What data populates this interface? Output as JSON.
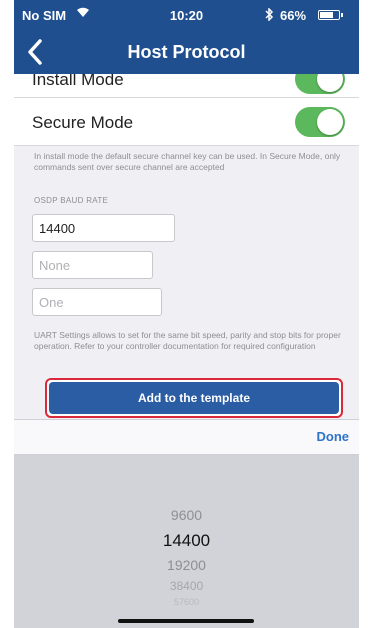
{
  "status_bar": {
    "carrier": "No SIM",
    "time": "10:20",
    "bluetooth_icon": "bluetooth-icon",
    "battery_percent": "66%",
    "battery_level": 0.66
  },
  "nav": {
    "title": "Host Protocol",
    "back_icon": "chevron-left-icon"
  },
  "settings": {
    "install_mode_label": "Install Mode",
    "install_mode_on": true,
    "secure_mode_label": "Secure Mode",
    "secure_mode_on": true,
    "secure_note": "In install mode the default secure channel key can be used. In Secure Mode, only commands sent over secure channel are accepted",
    "baud_caption": "OSDP BAUD RATE",
    "baud_value": "14400",
    "parity_placeholder": "None",
    "stop_bits_placeholder": "One",
    "uart_note": "UART Settings allows to set for the same bit speed, parity and stop bits for proper operation. Refer to your controller documentation for required configuration",
    "add_button": "Add to the template"
  },
  "toolbar": {
    "done": "Done"
  },
  "picker": {
    "options": [
      "9600",
      "14400",
      "19200",
      "38400",
      "57600"
    ],
    "selected": "14400"
  },
  "colors": {
    "nav_bg": "#1f4f8f",
    "toggle_on": "#5cb85c",
    "button_bg": "#2a5da4",
    "highlight_border": "#d9293a",
    "done_text": "#2d73c8"
  }
}
